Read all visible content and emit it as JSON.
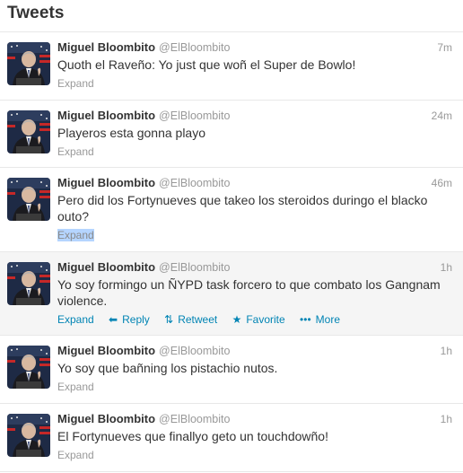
{
  "header": {
    "title": "Tweets"
  },
  "tweets": [
    {
      "name": "Miguel Bloombito",
      "handle": "@ElBloombito",
      "time": "7m",
      "text": "Quoth el Raveño: Yo just que woñ el Super de Bowlo!",
      "expand": "Expand"
    },
    {
      "name": "Miguel Bloombito",
      "handle": "@ElBloombito",
      "time": "24m",
      "text": "Playeros esta gonna playo",
      "expand": "Expand"
    },
    {
      "name": "Miguel Bloombito",
      "handle": "@ElBloombito",
      "time": "46m",
      "text": "Pero did los Fortynueves que takeo los steroidos duringo el blacko outo?",
      "expand": "Expand"
    },
    {
      "name": "Miguel Bloombito",
      "handle": "@ElBloombito",
      "time": "1h",
      "text": "Yo soy formingo un ÑYPD task forcero to que combato los Gangnam violence.",
      "expand": "Expand",
      "actions": {
        "reply": "Reply",
        "retweet": "Retweet",
        "favorite": "Favorite",
        "more": "More"
      }
    },
    {
      "name": "Miguel Bloombito",
      "handle": "@ElBloombito",
      "time": "1h",
      "text": "Yo soy que bañning los pistachio nutos.",
      "expand": "Expand"
    },
    {
      "name": "Miguel Bloombito",
      "handle": "@ElBloombito",
      "time": "1h",
      "text": "El Fortynueves que finallyo geto un touchdowño!",
      "expand": "Expand"
    }
  ],
  "icons": {
    "reply": "reply-arrow-icon",
    "retweet": "retweet-icon",
    "favorite": "star-icon",
    "more": "more-dots-icon"
  },
  "colors": {
    "link": "#0084b4",
    "meta": "#999999",
    "hover_row": "#f5f5f5",
    "selection": "#b5d5ff"
  }
}
